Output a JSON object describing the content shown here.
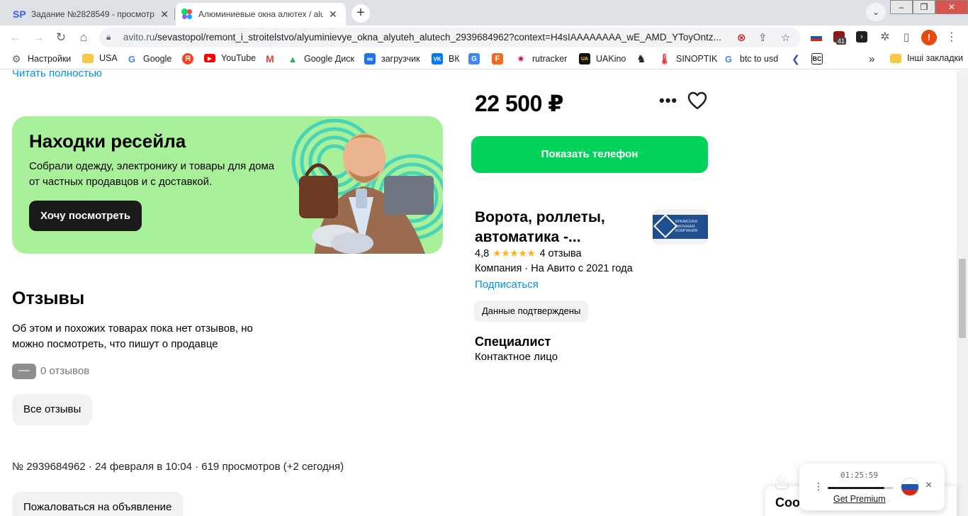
{
  "browser": {
    "tabs": [
      {
        "title": "Задание №2828549 - просмотр",
        "favicon": "SP",
        "active": false
      },
      {
        "title": "Алюминиевые окна алютех / alutech",
        "favicon": "avito-dots",
        "active": true
      }
    ],
    "new_tab": "+",
    "url_host": "avito.ru",
    "url_path": "/sevastopol/remont_i_stroitelstvo/alyuminievye_okna_alyuteh_alutech_2939684962?context=H4sIAAAAAAAA_wE_AMD_YToyOntz...",
    "extension_badge": "41",
    "profile_initial": "!",
    "bookmarks": [
      {
        "label": "Настройки",
        "icon": "gear-icon"
      },
      {
        "label": "USA",
        "icon": "folder-icon"
      },
      {
        "label": "Google",
        "icon": "google-icon"
      },
      {
        "label": "",
        "icon": "yandex-icon"
      },
      {
        "label": "YouTube",
        "icon": "youtube-icon"
      },
      {
        "label": "",
        "icon": "gmail-icon"
      },
      {
        "label": "Google Диск",
        "icon": "drive-icon"
      },
      {
        "label": "загрузчик",
        "icon": "infinity-icon"
      },
      {
        "label": "ВК",
        "icon": "vk-icon"
      },
      {
        "label": "",
        "icon": "translate-icon"
      },
      {
        "label": "",
        "icon": "f-icon"
      },
      {
        "label": "rutracker",
        "icon": "rutracker-icon"
      },
      {
        "label": "UAKino",
        "icon": "uakino-icon"
      },
      {
        "label": "",
        "icon": "chess-icon"
      },
      {
        "label": "SINOPTIK",
        "icon": "thermometer-icon"
      },
      {
        "label": "btc to usd",
        "icon": "google-icon"
      },
      {
        "label": "",
        "icon": "arrow-icon"
      },
      {
        "label": "",
        "icon": "bc-icon"
      }
    ],
    "bookmarks_more": "»",
    "other_bookmarks": "Інші закладки"
  },
  "page": {
    "read_more": "Читать полностью",
    "banner": {
      "title": "Находки ресейла",
      "text": "Собрали одежду, электронику и товары для дома от частных продавцов и с доставкой.",
      "button": "Хочу посмотреть"
    },
    "reviews": {
      "title": "Отзывы",
      "text": "Об этом и похожих товарах пока нет отзывов, но можно посмотреть, что пишут о продавце",
      "rating_placeholder": "—",
      "count": "0 отзывов",
      "all_button": "Все отзывы"
    },
    "meta": "№ 2939684962 · 24 февраля в 10:04 · 619 просмотров (+2 сегодня)",
    "complain": "Пожаловаться на объявление",
    "price": "22 500 ₽",
    "more": "•••",
    "show_phone": "Показать телефон",
    "seller": {
      "name": "Ворота, роллеты, автоматика -...",
      "logo_text": "КРЫМСКАЯ ОКОННАЯ КОМПАНИЯ",
      "rating": "4,8",
      "stars": "★★★★★",
      "reviews": "4 отзыва",
      "type": "Компания · На Авито с 2021 года",
      "subscribe": "Подписаться",
      "verified": "Данные подтверждены",
      "contact_title": "Специалист",
      "contact_sub": "Контактное лицо"
    }
  },
  "widgets": {
    "cookie_text": "Coo",
    "vpn_timer": "01:25:59",
    "vpn_premium": "Get Premium",
    "vpn_close": "×"
  },
  "colors": {
    "avito_blue": "#0091e6",
    "phone_green": "#02d15c",
    "banner_green": "#a9f09a",
    "star": "#ffb021"
  }
}
